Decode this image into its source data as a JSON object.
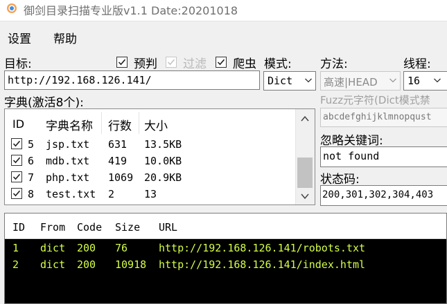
{
  "window": {
    "title": "御剑目录扫描专业版v1.1 Date:20201018"
  },
  "menu": {
    "settings": "设置",
    "help": "帮助"
  },
  "target": {
    "label": "目标:",
    "value": "http://192.168.126.141/"
  },
  "options": {
    "predict": "预判",
    "filter": "过滤",
    "crawler": "爬虫"
  },
  "mode": {
    "label": "模式:",
    "value": "Dict"
  },
  "method": {
    "label": "方法:",
    "value": "高速|HEAD"
  },
  "threads": {
    "label": "线程:",
    "value": "16"
  },
  "dict": {
    "label": "字典(激活8个):",
    "headers": {
      "id": "ID",
      "name": "字典名称",
      "lines": "行数",
      "size": "大小"
    },
    "rows": [
      {
        "id": "5",
        "name": "jsp.txt",
        "lines": "631",
        "size": "13.5KB",
        "checked": true
      },
      {
        "id": "6",
        "name": "mdb.txt",
        "lines": "419",
        "size": "10.0KB",
        "checked": true
      },
      {
        "id": "7",
        "name": "php.txt",
        "lines": "1069",
        "size": "20.9KB",
        "checked": true
      },
      {
        "id": "8",
        "name": "test.txt",
        "lines": "2",
        "size": "13",
        "checked": true
      }
    ]
  },
  "fuzz": {
    "label": "Fuzz元字符(Dict模式禁",
    "value": "abcdefghijklmnopqust"
  },
  "ignore": {
    "label": "忽略关键词:",
    "value": "not found"
  },
  "status": {
    "label": "状态码:",
    "value": "200,301,302,304,403"
  },
  "results": {
    "headers": {
      "id": "ID",
      "from": "From",
      "code": "Code",
      "size": "Size",
      "url": "URL"
    },
    "rows": [
      {
        "id": "1",
        "from": "dict",
        "code": "200",
        "size": "76",
        "url": "http://192.168.126.141/robots.txt"
      },
      {
        "id": "2",
        "from": "dict",
        "code": "200",
        "size": "10918",
        "url": "http://192.168.126.141/index.html"
      }
    ]
  },
  "colors": {
    "result_text": "#d4ff47",
    "result_bg": "#000000",
    "window_bg": "#f0f0f0"
  }
}
